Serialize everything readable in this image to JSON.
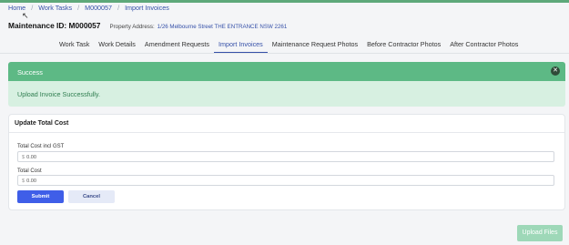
{
  "breadcrumb": {
    "items": [
      "Home",
      "Work Tasks",
      "M000057",
      "Import Invoices"
    ],
    "separator": "/"
  },
  "header": {
    "maintenance_id": "Maintenance ID: M000057",
    "property_label": "Property Address:",
    "property_value": "1/26 Melbourne Street THE ENTRANCE NSW 2261"
  },
  "tabs": [
    {
      "label": "Work Task",
      "active": false
    },
    {
      "label": "Work Details",
      "active": false
    },
    {
      "label": "Amendment Requests",
      "active": false
    },
    {
      "label": "Import Invoices",
      "active": true
    },
    {
      "label": "Maintenance Request Photos",
      "active": false
    },
    {
      "label": "Before Contractor Photos",
      "active": false
    },
    {
      "label": "After Contractor Photos",
      "active": false
    }
  ],
  "alert": {
    "title": "Success",
    "message": "Upload Invoice Successfully.",
    "close_icon": "close-icon",
    "header_color": "#5db985",
    "body_color": "#d7f0e1"
  },
  "card": {
    "title": "Update Total Cost",
    "fields": [
      {
        "label": "Total Cost incl GST",
        "currency": "$",
        "value": "0.00"
      },
      {
        "label": "Total Cost",
        "currency": "$",
        "value": "0.00"
      }
    ],
    "submit_label": "Submit",
    "cancel_label": "Cancel"
  },
  "upload_button": {
    "label": "Upload Files"
  },
  "colors": {
    "accent": "#3f5ee8",
    "link": "#3550a8",
    "success": "#5db985"
  }
}
